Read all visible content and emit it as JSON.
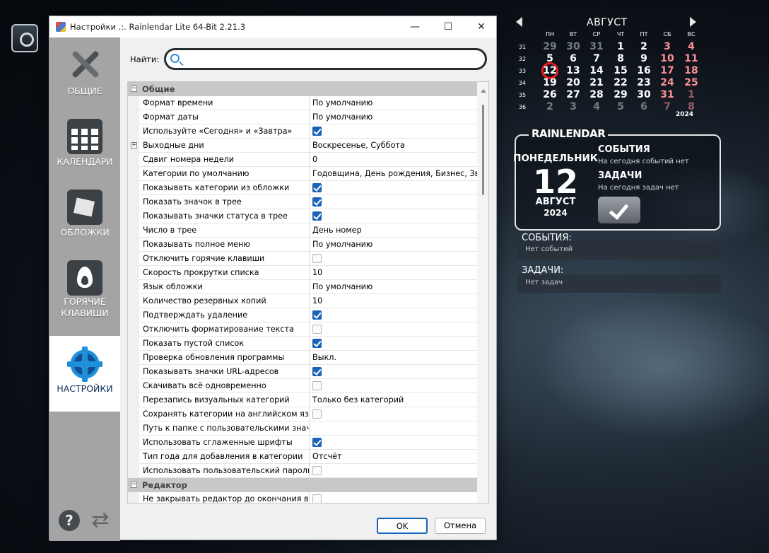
{
  "desktop": {
    "calendar": {
      "month": "АВГУСТ",
      "year": "2024",
      "weekdays": [
        "ПН",
        "ВТ",
        "СР",
        "ЧТ",
        "ПТ",
        "СБ",
        "ВС"
      ],
      "weeks": [
        {
          "num": "31",
          "days": [
            {
              "d": "29",
              "t": "dim"
            },
            {
              "d": "30",
              "t": "dim"
            },
            {
              "d": "31",
              "t": "dim"
            },
            {
              "d": "1",
              "t": ""
            },
            {
              "d": "2",
              "t": ""
            },
            {
              "d": "3",
              "t": "we"
            },
            {
              "d": "4",
              "t": "we"
            }
          ]
        },
        {
          "num": "32",
          "days": [
            {
              "d": "5",
              "t": ""
            },
            {
              "d": "6",
              "t": ""
            },
            {
              "d": "7",
              "t": ""
            },
            {
              "d": "8",
              "t": ""
            },
            {
              "d": "9",
              "t": ""
            },
            {
              "d": "10",
              "t": "we"
            },
            {
              "d": "11",
              "t": "we"
            }
          ]
        },
        {
          "num": "33",
          "days": [
            {
              "d": "12",
              "t": "today"
            },
            {
              "d": "13",
              "t": ""
            },
            {
              "d": "14",
              "t": ""
            },
            {
              "d": "15",
              "t": ""
            },
            {
              "d": "16",
              "t": ""
            },
            {
              "d": "17",
              "t": "we"
            },
            {
              "d": "18",
              "t": "we"
            }
          ]
        },
        {
          "num": "34",
          "days": [
            {
              "d": "19",
              "t": ""
            },
            {
              "d": "20",
              "t": ""
            },
            {
              "d": "21",
              "t": ""
            },
            {
              "d": "22",
              "t": ""
            },
            {
              "d": "23",
              "t": ""
            },
            {
              "d": "24",
              "t": "we"
            },
            {
              "d": "25",
              "t": "we"
            }
          ]
        },
        {
          "num": "35",
          "days": [
            {
              "d": "26",
              "t": ""
            },
            {
              "d": "27",
              "t": ""
            },
            {
              "d": "28",
              "t": ""
            },
            {
              "d": "29",
              "t": ""
            },
            {
              "d": "30",
              "t": ""
            },
            {
              "d": "31",
              "t": "we"
            },
            {
              "d": "1",
              "t": "dimwe"
            }
          ]
        },
        {
          "num": "36",
          "days": [
            {
              "d": "2",
              "t": "dim"
            },
            {
              "d": "3",
              "t": "dim"
            },
            {
              "d": "4",
              "t": "dim"
            },
            {
              "d": "5",
              "t": "dim"
            },
            {
              "d": "6",
              "t": "dim"
            },
            {
              "d": "7",
              "t": "dimwe"
            },
            {
              "d": "8",
              "t": "dimwe"
            }
          ]
        }
      ]
    },
    "agenda": {
      "logo": "RAINLENDAR",
      "day_name": "ПОНЕДЕЛЬНИК",
      "day_num": "12",
      "month": "АВГУСТ",
      "year": "2024",
      "events_title": "СОБЫТИЯ",
      "events_text": "На сегодня событий нет",
      "tasks_title": "ЗАДАЧИ",
      "tasks_text": "На сегодня задач нет"
    },
    "events_list": {
      "title": "СОБЫТИЯ:",
      "text": "Нет событий"
    },
    "tasks_list": {
      "title": "ЗАДАЧИ:",
      "text": "Нет задач"
    }
  },
  "dialog": {
    "title": "Настройки .:. Rainlendar Lite 64-Bit 2.21.3",
    "buttons": {
      "minimize": "—",
      "maximize": "☐",
      "close": "✕",
      "ok": "OK",
      "cancel": "Отмена"
    },
    "nav": [
      {
        "id": "general",
        "label": "ОБЩИЕ",
        "icon": "tools-icon",
        "active": false
      },
      {
        "id": "calendars",
        "label": "КАЛЕНДАРИ",
        "icon": "calendar-icon",
        "active": false
      },
      {
        "id": "skins",
        "label": "ОБЛОЖКИ",
        "icon": "skins-icon",
        "active": false
      },
      {
        "id": "hotkeys",
        "label": "ГОРЯЧИЕ КЛАВИШИ",
        "icon": "fire-icon",
        "active": false
      },
      {
        "id": "settings",
        "label": "НАСТРОЙКИ",
        "icon": "gear-icon",
        "active": true
      }
    ],
    "search": {
      "label": "Найти:",
      "value": ""
    },
    "help_glyph": "?",
    "refresh_glyph": "⇄",
    "rows": [
      {
        "type": "cat",
        "name": "Общие",
        "toggle": "−"
      },
      {
        "name": "Формат времени",
        "value": "По умолчанию"
      },
      {
        "name": "Формат даты",
        "value": "По умолчанию"
      },
      {
        "name": "Используйте «Сегодня» и «Завтра»",
        "check": true
      },
      {
        "name": "Выходные дни",
        "value": "Воскресенье, Суббота",
        "toggle": "+"
      },
      {
        "name": "Сдвиг номера недели",
        "value": "0"
      },
      {
        "name": "Категории по умолчанию",
        "value": "Годовщина, День рождения, Бизнес, Звонк"
      },
      {
        "name": "Показывать категории из обложки",
        "check": true
      },
      {
        "name": "Показать значок в трее",
        "check": true
      },
      {
        "name": "Показывать значки статуса в трее",
        "check": true
      },
      {
        "name": "Число в трее",
        "value": "День номер"
      },
      {
        "name": "Показывать полное меню",
        "value": "По умолчанию"
      },
      {
        "name": "Отключить горячие клавиши",
        "check": false
      },
      {
        "name": "Скорость прокрутки списка",
        "value": "10"
      },
      {
        "name": "Язык обложки",
        "value": "По умолчанию"
      },
      {
        "name": "Количество резервных копий",
        "value": "10"
      },
      {
        "name": "Подтверждать удаление",
        "check": true
      },
      {
        "name": "Отключить форматирование текста",
        "check": false
      },
      {
        "name": "Показать пустой список",
        "check": true
      },
      {
        "name": "Проверка обновления программы",
        "value": "Выкл."
      },
      {
        "name": "Показывать значки URL-адресов",
        "check": true
      },
      {
        "name": "Скачивать всё одновременно",
        "check": false
      },
      {
        "name": "Перезапись визуальных категорий",
        "value": "Только без категорий"
      },
      {
        "name": "Сохранять категории на английском языке",
        "check": false
      },
      {
        "name": "Путь к папке с пользовательскими значками",
        "value": ""
      },
      {
        "name": "Использовать сглаженные шрифты",
        "check": true
      },
      {
        "name": "Тип года для добавления в категории",
        "value": "Отсчёт"
      },
      {
        "name": "Использовать пользовательский пароль ц",
        "check": false
      },
      {
        "type": "cat",
        "name": "Редактор",
        "toggle": "−"
      },
      {
        "name": "Не закрывать редактор до окончания ввода",
        "check": false
      }
    ]
  }
}
